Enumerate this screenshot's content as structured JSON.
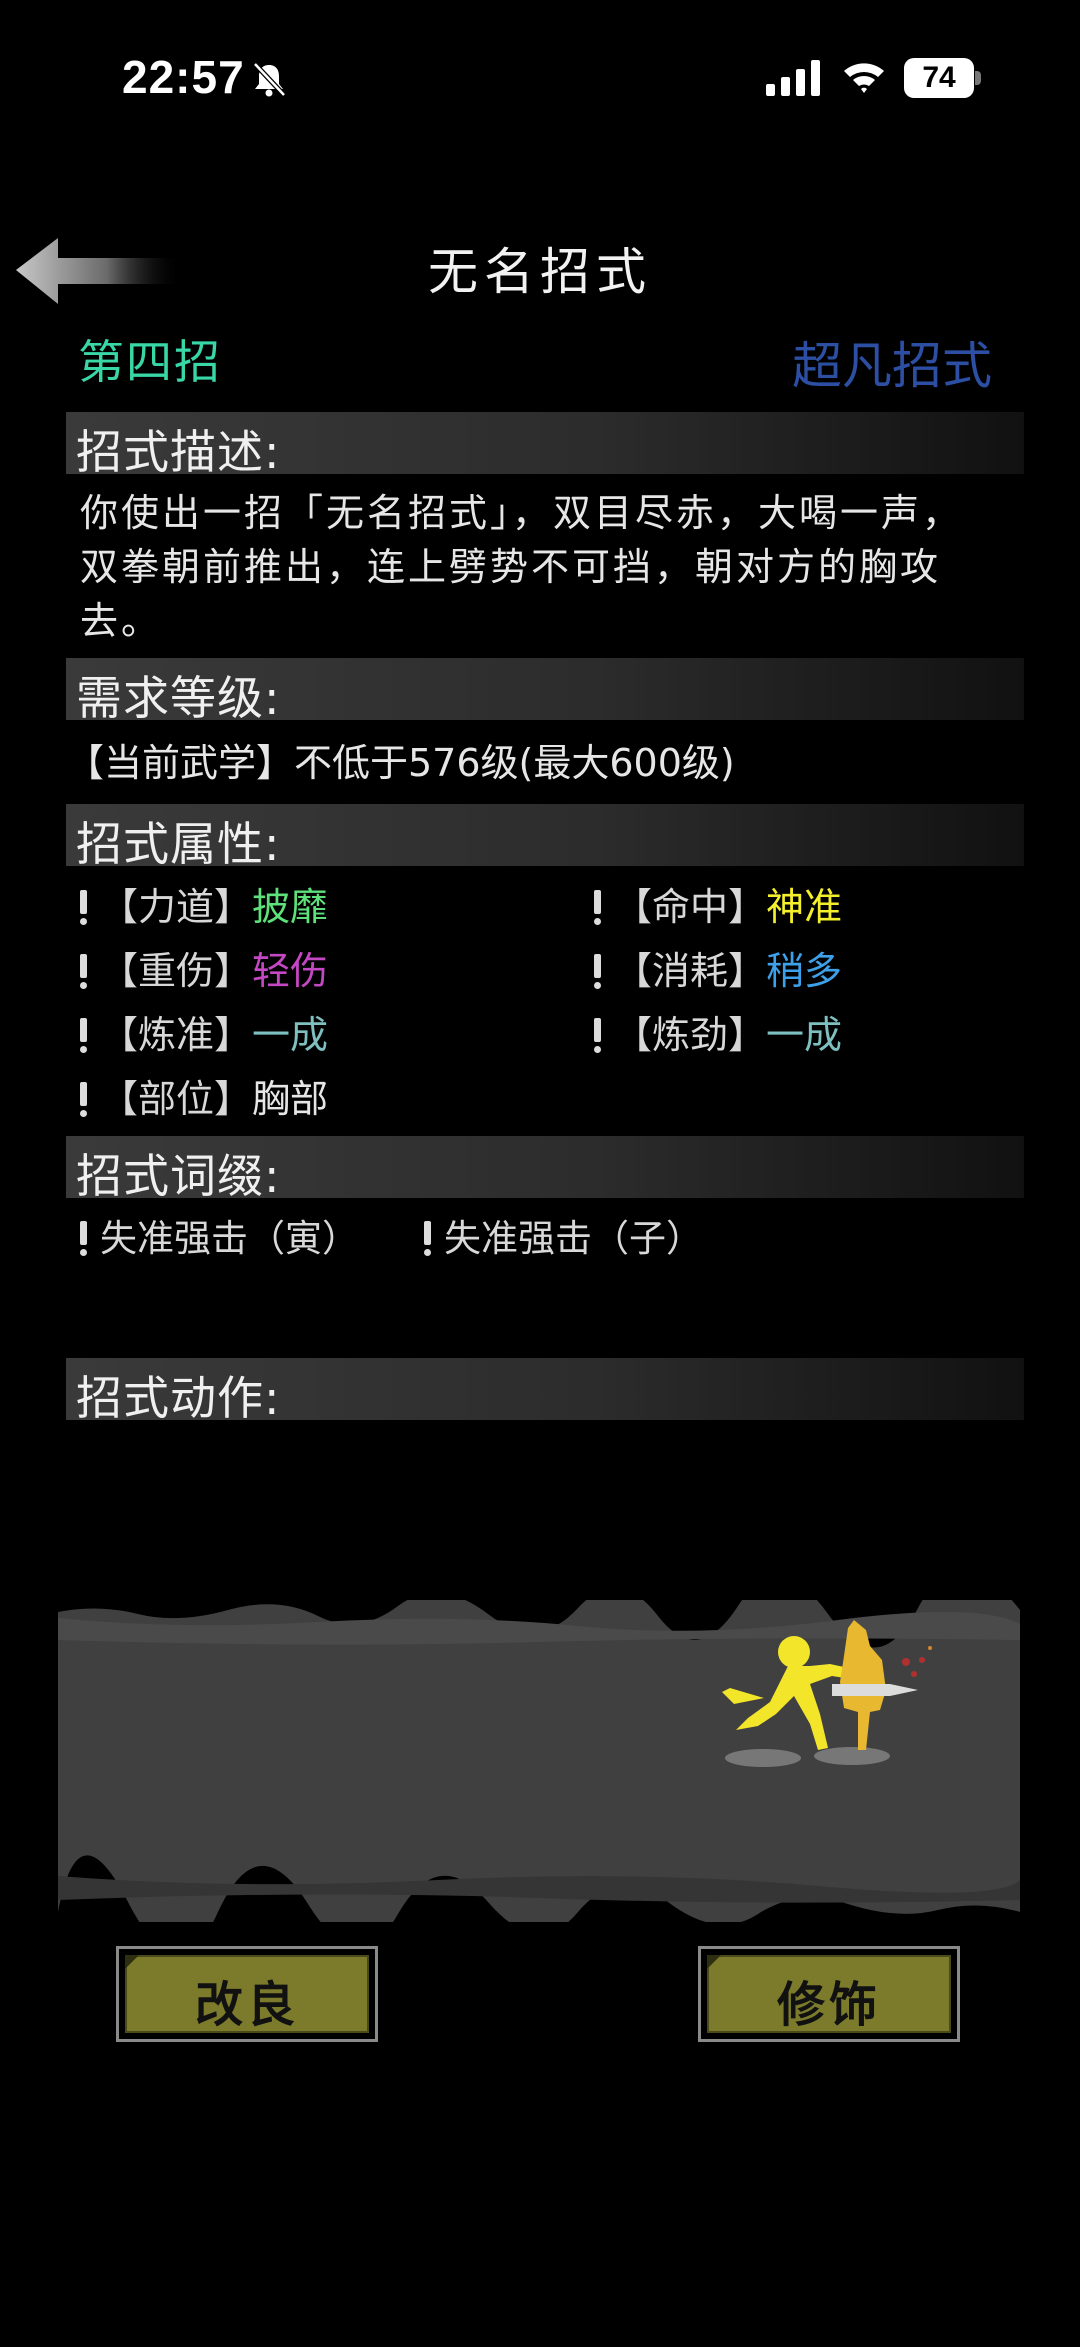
{
  "status_bar": {
    "time": "22:57",
    "battery": "74"
  },
  "header": {
    "title": "无名招式",
    "move_no": "第四招",
    "grade": "超凡招式"
  },
  "sections": {
    "desc_title": "招式描述:",
    "req_title": "需求等级:",
    "attr_title": "招式属性:",
    "affix_title": "招式词缀:",
    "action_title": "招式动作:"
  },
  "description": "你使出一招「无名招式」，双目尽赤，大喝一声，双拳朝前推出，连上劈势不可挡，朝对方的胸攻去。",
  "requirement": "【当前武学】不低于576级(最大600级)",
  "attributes": [
    {
      "label": "【力道】",
      "value": "披靡",
      "color": "#5ee07a"
    },
    {
      "label": "【命中】",
      "value": "神准",
      "color": "#f4ef2c"
    },
    {
      "label": "【重伤】",
      "value": "轻伤",
      "color": "#c447c4"
    },
    {
      "label": "【消耗】",
      "value": "稍多",
      "color": "#3fa0ea"
    },
    {
      "label": "【炼准】",
      "value": "一成",
      "color": "#7ebfbf"
    },
    {
      "label": "【炼劲】",
      "value": "一成",
      "color": "#7ebfbf"
    },
    {
      "label": "【部位】",
      "value": "胸部",
      "color": "#e6e6e6"
    }
  ],
  "affixes": [
    "失准强击（寅）",
    "失准强击（子）"
  ],
  "buttons": {
    "improve": "改良",
    "decorate": "修饰"
  }
}
